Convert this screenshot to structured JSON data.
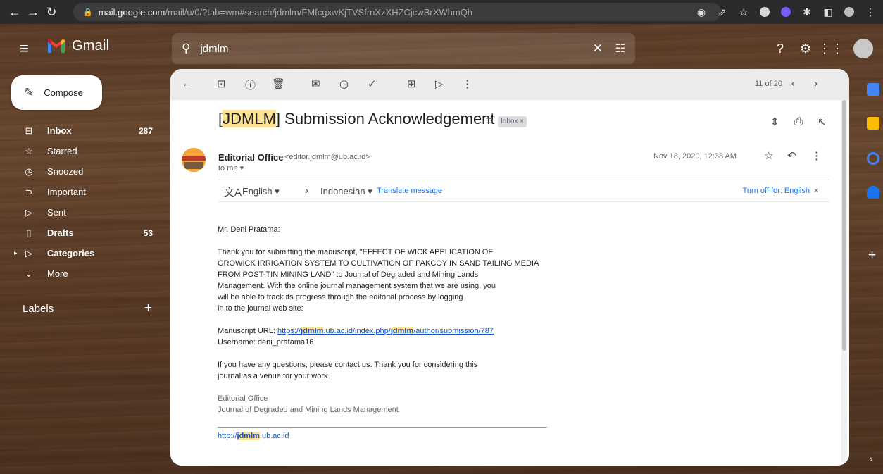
{
  "browser": {
    "url_host": "mail.google.com",
    "url_path": "/mail/u/0/?tab=wm#search/jdmlm/FMfcgxwKjTVSfrnXzXHZCjcwBrXWhmQh"
  },
  "app": {
    "name": "Gmail"
  },
  "search": {
    "query": "jdmlm"
  },
  "compose": {
    "label": "Compose"
  },
  "sidebar": {
    "items": [
      {
        "label": "Inbox",
        "count": "287"
      },
      {
        "label": "Starred",
        "count": ""
      },
      {
        "label": "Snoozed",
        "count": ""
      },
      {
        "label": "Important",
        "count": ""
      },
      {
        "label": "Sent",
        "count": ""
      },
      {
        "label": "Drafts",
        "count": "53"
      },
      {
        "label": "Categories",
        "count": ""
      },
      {
        "label": "More",
        "count": ""
      }
    ],
    "labels_header": "Labels"
  },
  "toolbar": {
    "pager": "11 of 20"
  },
  "email": {
    "subject_tag": "JDMLM",
    "subject_rest": " Submission Acknowledgement",
    "chip": "Inbox ×",
    "sender_name": "Editorial Office",
    "sender_email": "<editor.jdmlm@ub.ac.id>",
    "to": "to me ▾",
    "date": "Nov 18, 2020, 12:38 AM",
    "translate": {
      "from": "English ▾",
      "to": "Indonesian ▾",
      "link": "Translate message",
      "off": "Turn off for: English"
    },
    "greeting": "Mr. Deni Pratama:",
    "para1": [
      "Thank you for submitting the manuscript, \"EFFECT OF WICK APPLICATION OF",
      "GROWICK IRRIGATION SYSTEM TO CULTIVATION OF PAKCOY IN SAND TAILING MEDIA",
      "FROM POST-TIN MINING LAND\" to Journal of Degraded and Mining Lands",
      "Management. With the online journal management system that we are using, you",
      "will be able to track its progress through the editorial process by logging",
      "in to the journal web site:"
    ],
    "manuscript_label": "Manuscript URL: ",
    "url_a": "https://",
    "url_b": "jdmlm",
    "url_c": ".ub.ac.id/index.php/",
    "url_d": "jdmlm",
    "url_e": "/author/submission/787",
    "username": "Username: deni_pratama16",
    "para3_l1": "If you have any questions, please contact us. Thank you for considering this",
    "para3_l2": "journal as a venue for your work.",
    "sig1": "Editorial Office",
    "sig2": "Journal of Degraded and Mining Lands Management",
    "site_a": "http://",
    "site_b": "jdmlm",
    "site_c": ".ub.ac.id"
  }
}
